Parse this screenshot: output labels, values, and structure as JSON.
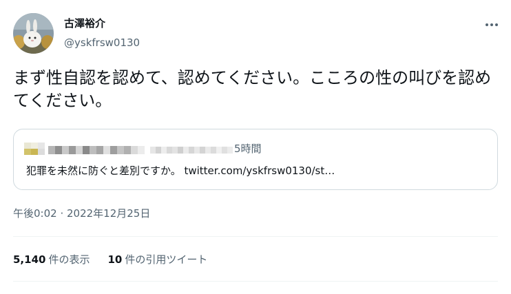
{
  "author": {
    "name": "古澤裕介",
    "handle": "@yskfrsw0130"
  },
  "tweet": {
    "text": "まず性自認を認めて、認めてください。こころの性の叫びを認めてください。",
    "timestamp": "午後0:02 · 2022年12月25日"
  },
  "quote": {
    "time": "5時間",
    "text": "犯罪を未然に防ぐと差別ですか。 twitter.com/yskfrsw0130/st…"
  },
  "stats": {
    "views_count": "5,140",
    "views_label": "件の表示",
    "quotes_count": "10",
    "quotes_label": "件の引用ツイート"
  },
  "icons": {
    "more": "more-dots-icon",
    "avatar": "rabbit-photo-avatar"
  },
  "colors": {
    "text": "#0f1419",
    "secondary": "#536471",
    "border": "#cfd9de",
    "divider": "#eff3f4"
  }
}
